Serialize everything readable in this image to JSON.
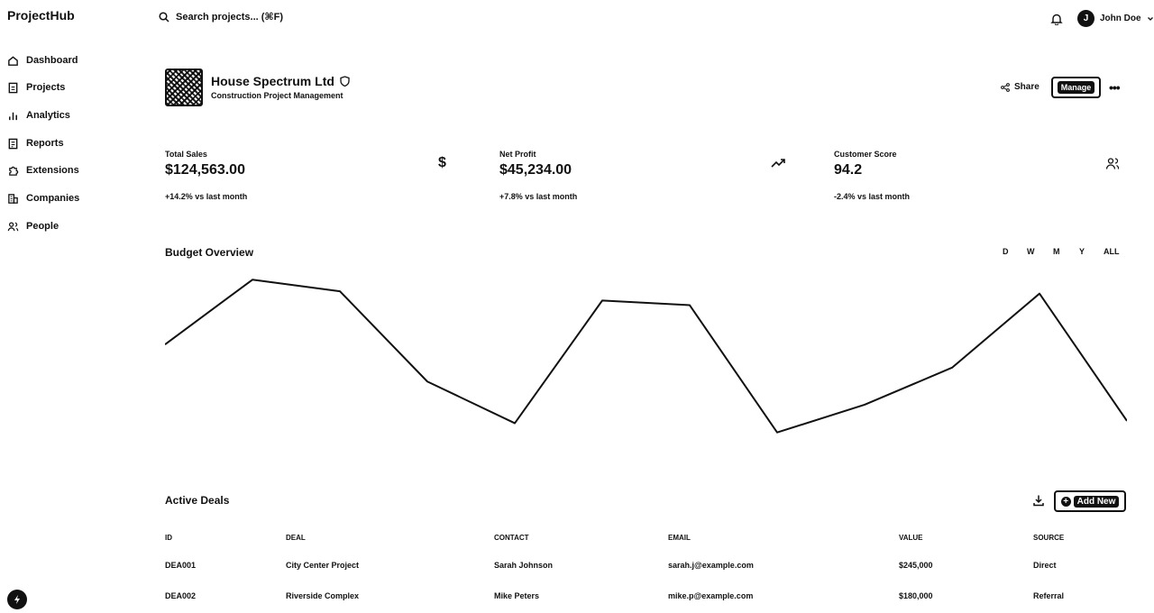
{
  "app": {
    "name": "ProjectHub"
  },
  "sidebar": {
    "items": [
      {
        "label": "Dashboard",
        "icon": "home-icon"
      },
      {
        "label": "Projects",
        "icon": "document-icon"
      },
      {
        "label": "Analytics",
        "icon": "bar-chart-icon"
      },
      {
        "label": "Reports",
        "icon": "report-icon"
      },
      {
        "label": "Extensions",
        "icon": "puzzle-icon"
      },
      {
        "label": "Companies",
        "icon": "building-icon"
      },
      {
        "label": "People",
        "icon": "people-icon"
      }
    ]
  },
  "topbar": {
    "search_placeholder": "Search projects... (⌘F)",
    "user_initial": "J",
    "user_name": "John Doe"
  },
  "company": {
    "name": "House Spectrum Ltd",
    "subtitle": "Construction Project Management",
    "share_label": "Share",
    "manage_label": "Manage",
    "more_label": "•••"
  },
  "stats": [
    {
      "label": "Total Sales",
      "value": "$124,563.00",
      "change": "+14.2% vs last month",
      "icon": "dollar-icon"
    },
    {
      "label": "Net Profit",
      "value": "$45,234.00",
      "change": "+7.8% vs last month",
      "icon": "trending-up-icon"
    },
    {
      "label": "Customer Score",
      "value": "94.2",
      "change": "-2.4% vs last month",
      "icon": "users-icon"
    }
  ],
  "budget": {
    "title": "Budget Overview",
    "ranges": [
      "D",
      "W",
      "M",
      "Y",
      "ALL"
    ]
  },
  "chart_data": {
    "type": "line",
    "title": "Budget Overview",
    "x": [
      1,
      2,
      3,
      4,
      5,
      6,
      7,
      8,
      9,
      10,
      11,
      12
    ],
    "values": [
      72,
      100,
      95,
      56,
      38,
      91,
      89,
      34,
      46,
      62,
      94,
      39
    ],
    "ylim": [
      30,
      104
    ],
    "grid": false,
    "color": "#111111"
  },
  "deals": {
    "title": "Active Deals",
    "add_label": "Add New",
    "columns": [
      "ID",
      "DEAL",
      "CONTACT",
      "EMAIL",
      "VALUE",
      "SOURCE"
    ],
    "rows": [
      [
        "DEA001",
        "City Center Project",
        "Sarah Johnson",
        "sarah.j@example.com",
        "$245,000",
        "Direct"
      ],
      [
        "DEA002",
        "Riverside Complex",
        "Mike Peters",
        "mike.p@example.com",
        "$180,000",
        "Referral"
      ]
    ]
  }
}
